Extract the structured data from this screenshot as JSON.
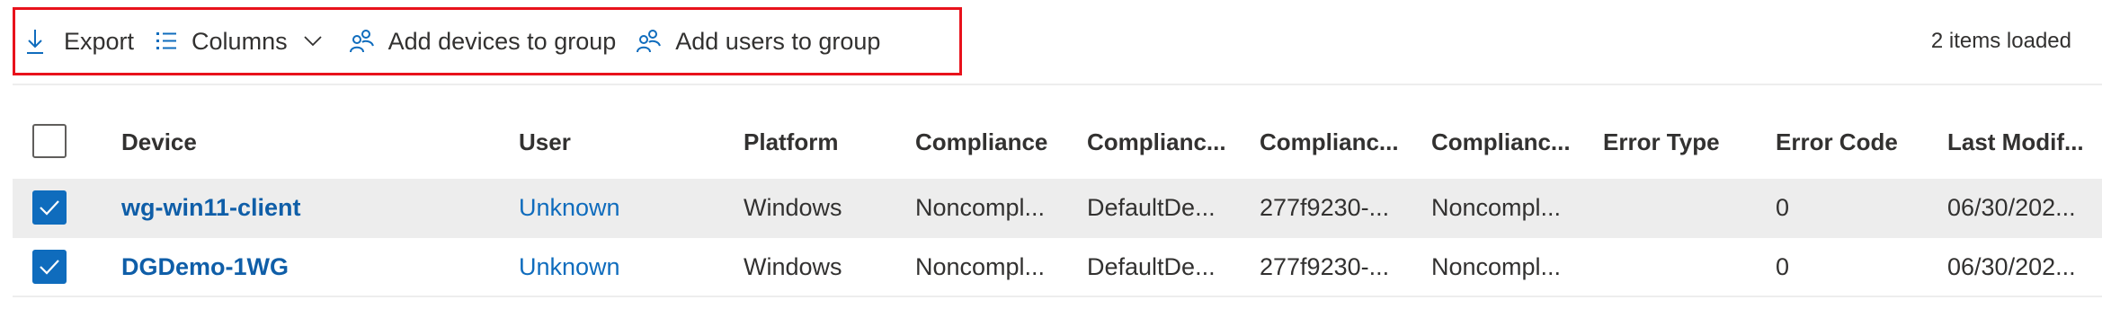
{
  "toolbar": {
    "export_label": "Export",
    "columns_label": "Columns",
    "add_devices_label": "Add devices to group",
    "add_users_label": "Add users to group"
  },
  "status": "2 items loaded",
  "columns": [
    "Device",
    "User",
    "Platform",
    "Compliance",
    "Complianc...",
    "Complianc...",
    "Complianc...",
    "Error Type",
    "Error Code",
    "Last Modif..."
  ],
  "rows": [
    {
      "selected": true,
      "device": "wg-win11-client",
      "user": "Unknown",
      "platform": "Windows",
      "compliance": "Noncompl...",
      "c2": "DefaultDe...",
      "c3": "277f9230-...",
      "c4": "Noncompl...",
      "error_type": "",
      "error_code": "0",
      "last_modified": "06/30/202..."
    },
    {
      "selected": true,
      "device": "DGDemo-1WG",
      "user": "Unknown",
      "platform": "Windows",
      "compliance": "Noncompl...",
      "c2": "DefaultDe...",
      "c3": "277f9230-...",
      "c4": "Noncompl...",
      "error_type": "",
      "error_code": "0",
      "last_modified": "06/30/202..."
    }
  ],
  "colors": {
    "accent": "#0f6cbd",
    "highlight_border": "#e8121c",
    "selected_row": "#ededed"
  },
  "icons": [
    "download-icon",
    "columns-list-icon",
    "chevron-down-icon",
    "people-add-icon"
  ]
}
